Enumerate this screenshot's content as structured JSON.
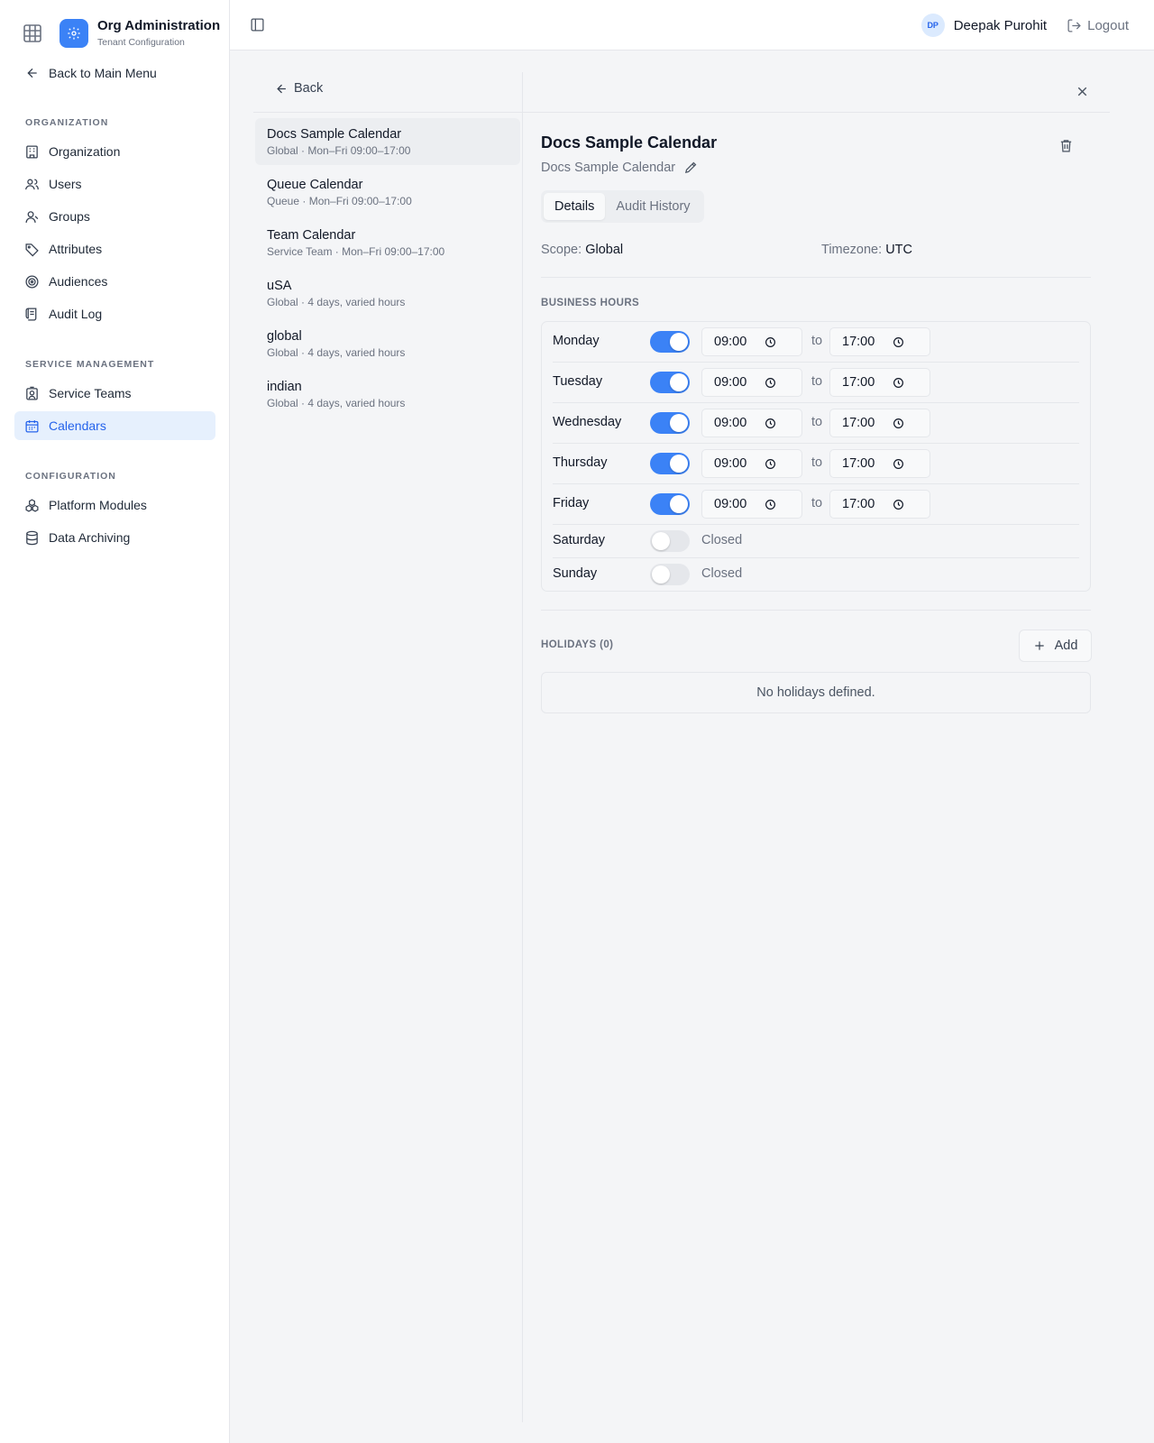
{
  "brand": {
    "title": "Org Administration",
    "subtitle": "Tenant Configuration",
    "back_label": "Back to Main Menu"
  },
  "nav": {
    "organization_heading": "ORGANIZATION",
    "organization_items": [
      {
        "label": "Organization",
        "icon": "building-icon"
      },
      {
        "label": "Users",
        "icon": "users-icon"
      },
      {
        "label": "Groups",
        "icon": "groups-icon"
      },
      {
        "label": "Attributes",
        "icon": "tag-icon"
      },
      {
        "label": "Audiences",
        "icon": "target-icon"
      },
      {
        "label": "Audit Log",
        "icon": "scroll-icon"
      }
    ],
    "service_heading": "SERVICE MANAGEMENT",
    "service_items": [
      {
        "label": "Service Teams",
        "icon": "badge-icon"
      },
      {
        "label": "Calendars",
        "icon": "calendar-icon",
        "active": true
      }
    ],
    "configuration_heading": "CONFIGURATION",
    "configuration_items": [
      {
        "label": "Platform Modules",
        "icon": "modules-icon"
      },
      {
        "label": "Data Archiving",
        "icon": "database-icon"
      }
    ]
  },
  "topbar": {
    "avatar_initials": "DP",
    "user_name": "Deepak Purohit",
    "logout_label": "Logout"
  },
  "list": {
    "back_label": "Back",
    "calendars": [
      {
        "name": "Docs Sample Calendar",
        "meta": "Global · Mon–Fri 09:00–17:00",
        "active": true
      },
      {
        "name": "Queue Calendar",
        "meta": "Queue · Mon–Fri 09:00–17:00"
      },
      {
        "name": "Team Calendar",
        "meta": "Service Team · Mon–Fri 09:00–17:00"
      },
      {
        "name": "uSA",
        "meta": "Global · 4 days, varied hours"
      },
      {
        "name": "global",
        "meta": "Global · 4 days, varied hours"
      },
      {
        "name": "indian",
        "meta": "Global · 4 days, varied hours"
      }
    ]
  },
  "detail": {
    "title": "Docs Sample Calendar",
    "subtitle": "Docs Sample Calendar",
    "tabs": [
      "Details",
      "Audit History"
    ],
    "active_tab": "Details",
    "scope_label": "Scope:",
    "scope_value": "Global",
    "timezone_label": "Timezone:",
    "timezone_value": "UTC",
    "business_hours_heading": "BUSINESS HOURS",
    "to_label": "to",
    "closed_label": "Closed",
    "days": [
      {
        "day": "Monday",
        "enabled": true,
        "start": "09:00",
        "end": "17:00"
      },
      {
        "day": "Tuesday",
        "enabled": true,
        "start": "09:00",
        "end": "17:00"
      },
      {
        "day": "Wednesday",
        "enabled": true,
        "start": "09:00",
        "end": "17:00"
      },
      {
        "day": "Thursday",
        "enabled": true,
        "start": "09:00",
        "end": "17:00"
      },
      {
        "day": "Friday",
        "enabled": true,
        "start": "09:00",
        "end": "17:00"
      },
      {
        "day": "Saturday",
        "enabled": false
      },
      {
        "day": "Sunday",
        "enabled": false
      }
    ],
    "holidays_heading": "HOLIDAYS (0)",
    "add_label": "Add",
    "empty_holidays": "No holidays defined."
  },
  "colors": {
    "accent": "#3b82f6",
    "active_nav_bg": "#e6f0fd"
  }
}
